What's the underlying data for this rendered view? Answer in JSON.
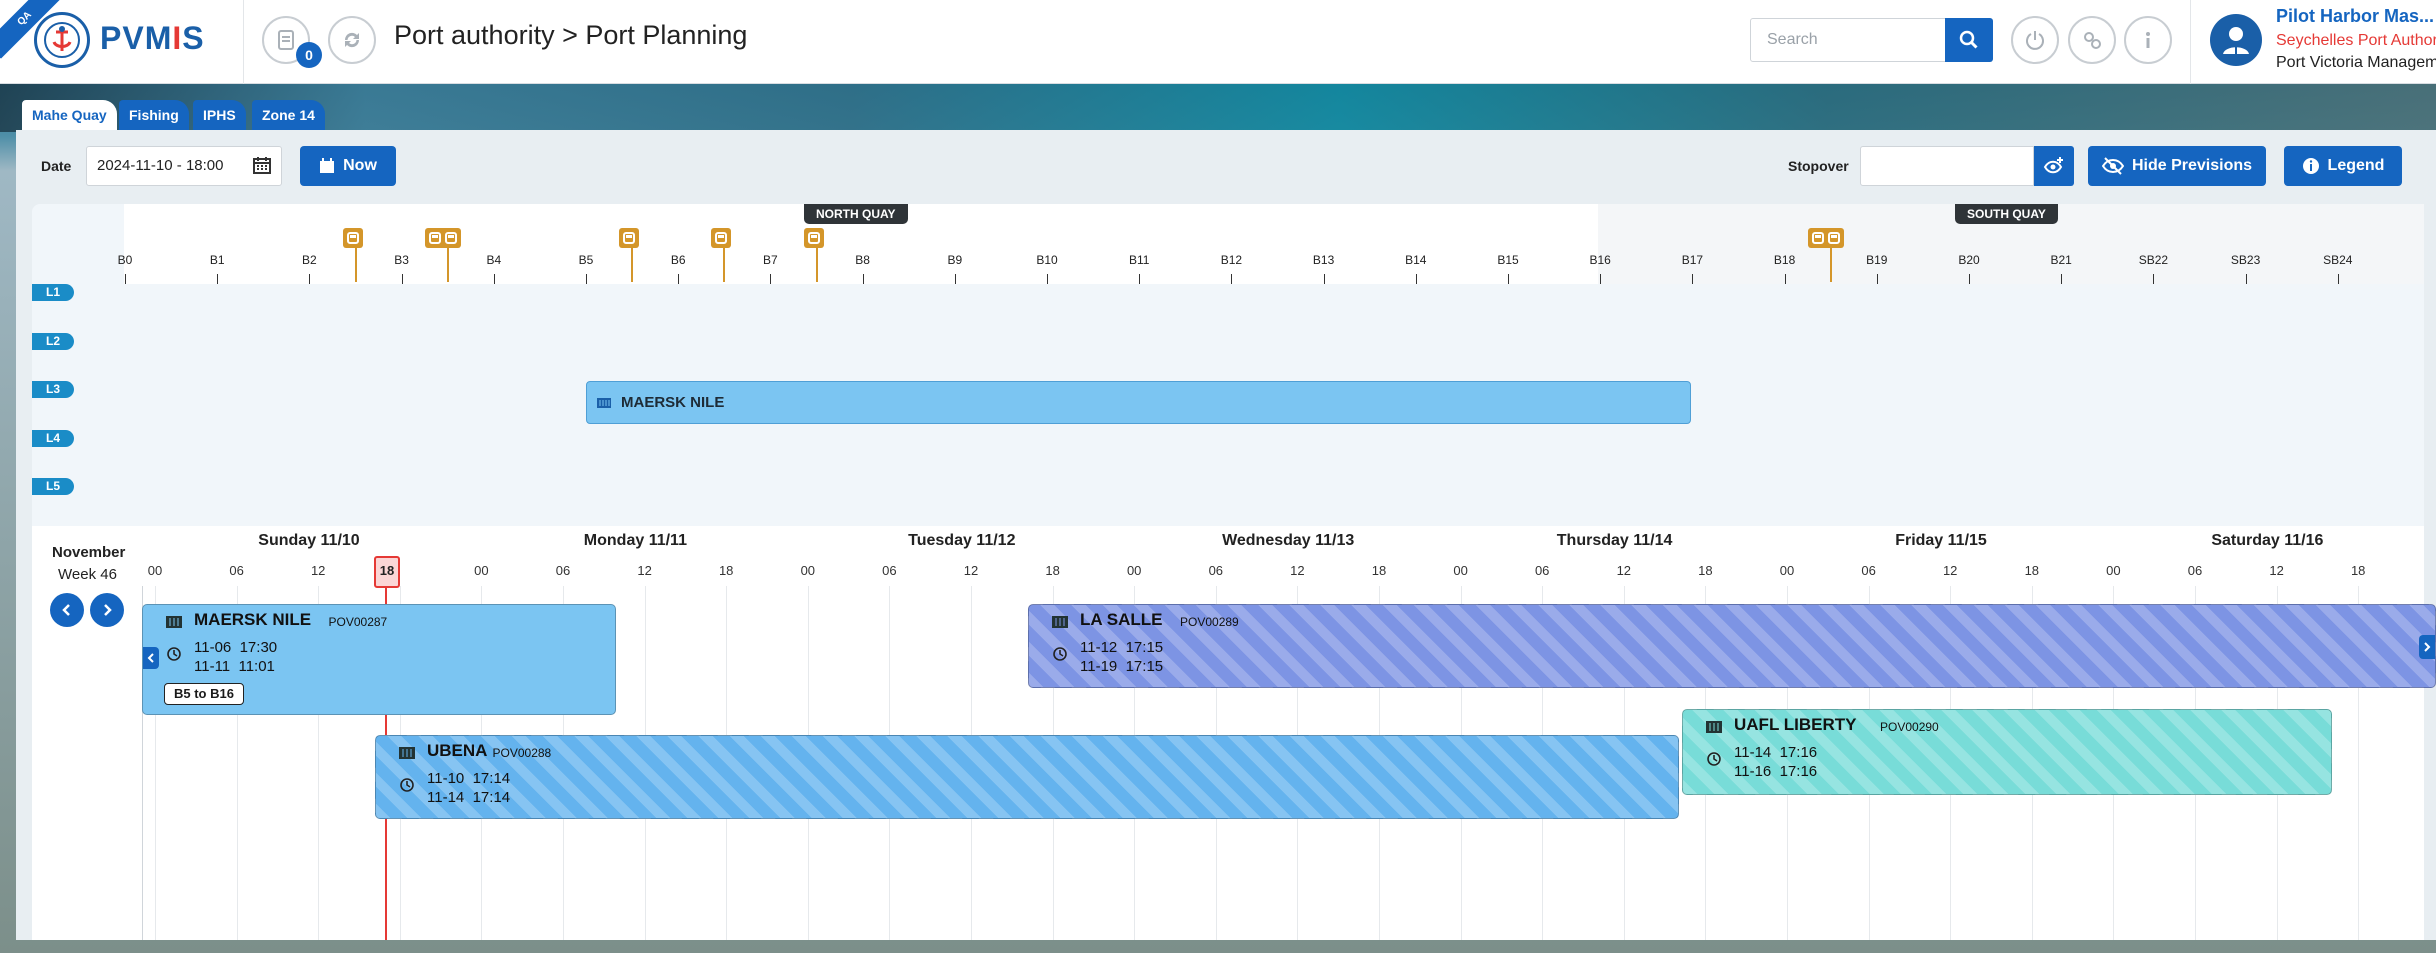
{
  "header": {
    "env_ribbon": "QA",
    "brand_prefix": "PVM",
    "brand_i": "I",
    "brand_suffix": "S",
    "notif_count": "0",
    "title": "Port authority > Port Planning",
    "search_placeholder": "Search",
    "user_name": "Pilot Harbor Mas...",
    "user_org": "Seychelles Port Author",
    "user_unit": "Port Victoria Managem"
  },
  "tabs": [
    "Mahe Quay",
    "Fishing",
    "IPHS",
    "Zone 14"
  ],
  "controls": {
    "date_label": "Date",
    "date_value": "2024-11-10 - 18:00",
    "now_label": "Now",
    "stopover_label": "Stopover",
    "hide_previsions_label": "Hide Previsions",
    "legend_label": "Legend"
  },
  "berth_map": {
    "north_label": "NORTH QUAY",
    "south_label": "SOUTH QUAY",
    "berths": [
      "B0",
      "B1",
      "B2",
      "B3",
      "B4",
      "B5",
      "B6",
      "B7",
      "B8",
      "B9",
      "B10",
      "B11",
      "B12",
      "B13",
      "B14",
      "B15",
      "B16",
      "B17",
      "B18",
      "B19",
      "B20",
      "B21",
      "SB22",
      "SB23",
      "SB24"
    ],
    "lanes": [
      "L1",
      "L2",
      "L3",
      "L4",
      "L5"
    ],
    "vessel": "MAERSK NILE"
  },
  "timeline": {
    "month": "November",
    "week": "Week 46",
    "days": [
      "Sunday 11/10",
      "Monday 11/11",
      "Tuesday 11/12",
      "Wednesday 11/13",
      "Thursday 11/14",
      "Friday 11/15",
      "Saturday 11/16"
    ],
    "hours": [
      "00",
      "06",
      "12",
      "18"
    ],
    "now_hour": "18"
  },
  "ships": [
    {
      "name": "MAERSK NILE",
      "code": "POV00287",
      "start": "11-06  17:30",
      "end": "11-11  11:01",
      "berths": "B5 to B16",
      "color": "#7bc5f2"
    },
    {
      "name": "LA SALLE",
      "code": "POV00289",
      "start": "11-12  17:15",
      "end": "11-19  17:15",
      "color": "#7d94e4"
    },
    {
      "name": "UBENA",
      "code": "POV00288",
      "start": "11-10  17:14",
      "end": "11-14  17:14",
      "color": "#64b3ee"
    },
    {
      "name": "UAFL LIBERTY",
      "code": "POV00290",
      "start": "11-14  17:16",
      "end": "11-16  17:16",
      "color": "#78dcd8"
    }
  ],
  "colors": {
    "primary": "#1565c0",
    "now_line": "#e53935",
    "marker": "#d4962a"
  }
}
